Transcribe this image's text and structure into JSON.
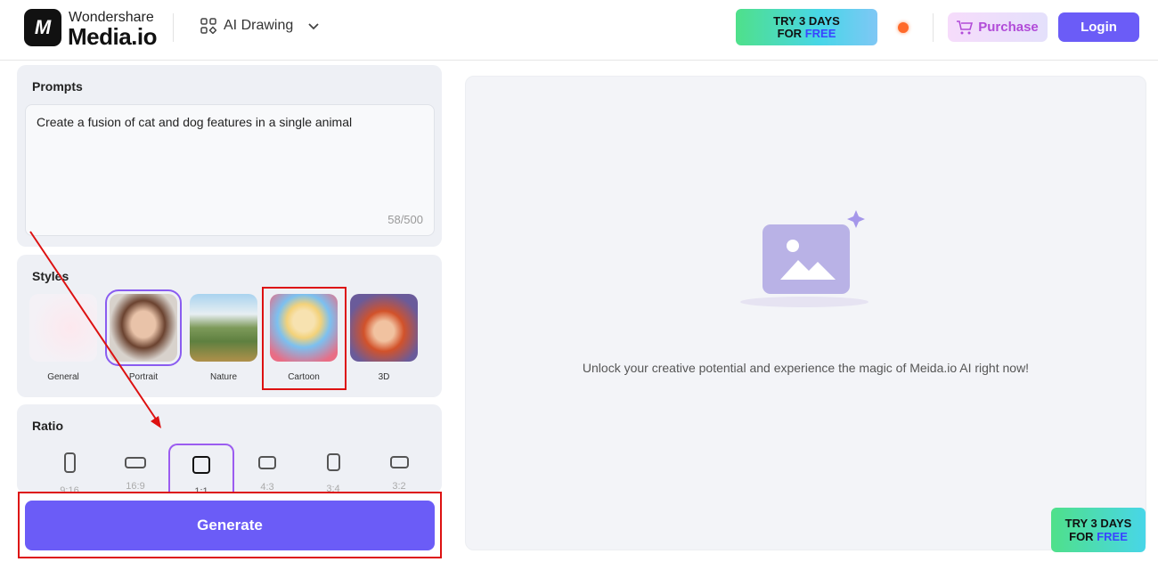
{
  "header": {
    "logo_mark": "M",
    "brand_small": "Wondershare",
    "brand_big": "Media.io",
    "tool_menu_label": "AI Drawing",
    "promo_line1": "TRY 3 DAYS",
    "promo_for": "FOR",
    "promo_free": "FREE",
    "purchase_label": "Purchase",
    "login_label": "Login"
  },
  "prompts": {
    "title": "Prompts",
    "value": "Create a fusion of cat and dog features in a single animal",
    "count": "58/500"
  },
  "styles": {
    "title": "Styles",
    "selected": "Portrait",
    "items": [
      {
        "label": "General"
      },
      {
        "label": "Portrait"
      },
      {
        "label": "Nature"
      },
      {
        "label": "Cartoon"
      },
      {
        "label": "3D"
      }
    ]
  },
  "ratio": {
    "title": "Ratio",
    "selected": "1:1",
    "items": [
      {
        "label": "9:16"
      },
      {
        "label": "16:9"
      },
      {
        "label": "1:1"
      },
      {
        "label": "4:3"
      },
      {
        "label": "3:4"
      },
      {
        "label": "3:2"
      }
    ]
  },
  "generate_label": "Generate",
  "preview": {
    "empty_text": "Unlock your creative potential and experience the magic of Meida.io AI right now!"
  },
  "floating_promo": {
    "line1": "TRY 3 DAYS",
    "for": "FOR",
    "free": "FREE"
  },
  "colors": {
    "accent": "#6b5cf7",
    "annotation": "#dd1111"
  }
}
